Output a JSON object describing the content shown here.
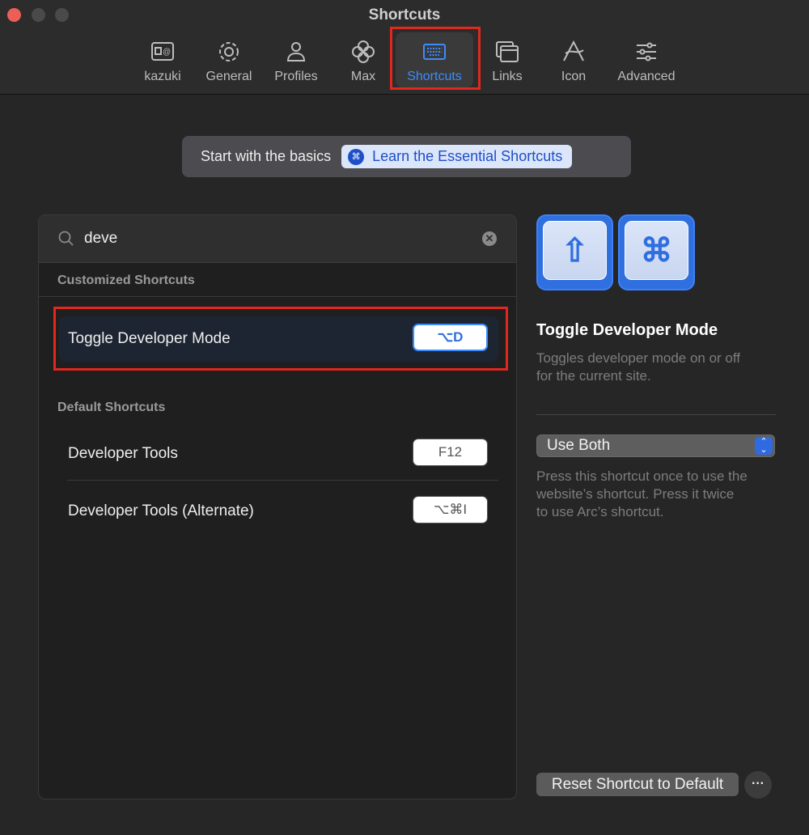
{
  "window": {
    "title": "Shortcuts"
  },
  "tabs": [
    {
      "label": "kazuki",
      "icon": "contact-card-icon"
    },
    {
      "label": "General",
      "icon": "gear-icon"
    },
    {
      "label": "Profiles",
      "icon": "person-icon"
    },
    {
      "label": "Max",
      "icon": "max-flower-icon"
    },
    {
      "label": "Shortcuts",
      "icon": "keyboard-icon",
      "active": true
    },
    {
      "label": "Links",
      "icon": "windows-icon"
    },
    {
      "label": "Icon",
      "icon": "arc-logo-icon"
    },
    {
      "label": "Advanced",
      "icon": "sliders-icon"
    }
  ],
  "banner": {
    "text": "Start with the basics",
    "button": "Learn the Essential Shortcuts",
    "button_icon": "⌘"
  },
  "search": {
    "value": "deve"
  },
  "sections": {
    "customized": {
      "title": "Customized Shortcuts",
      "items": [
        {
          "label": "Toggle Developer Mode",
          "shortcut": "⌥D"
        }
      ]
    },
    "default": {
      "title": "Default Shortcuts",
      "items": [
        {
          "label": "Developer Tools",
          "shortcut": "F12"
        },
        {
          "label": "Developer Tools (Alternate)",
          "shortcut": "⌥⌘I"
        }
      ]
    }
  },
  "detail": {
    "keys": [
      "⇧",
      "⌘"
    ],
    "title": "Toggle Developer Mode",
    "description_1": "Toggles developer mode on or off",
    "description_2": "for the current site.",
    "select_value": "Use Both",
    "help_1": "Press this shortcut once to use the",
    "help_2": "website’s shortcut. Press it twice",
    "help_3": "to use Arc’s shortcut.",
    "reset_button": "Reset Shortcut to Default",
    "more_button": "···"
  },
  "colors": {
    "accent": "#3b8cff",
    "highlight": "#e0281e"
  }
}
